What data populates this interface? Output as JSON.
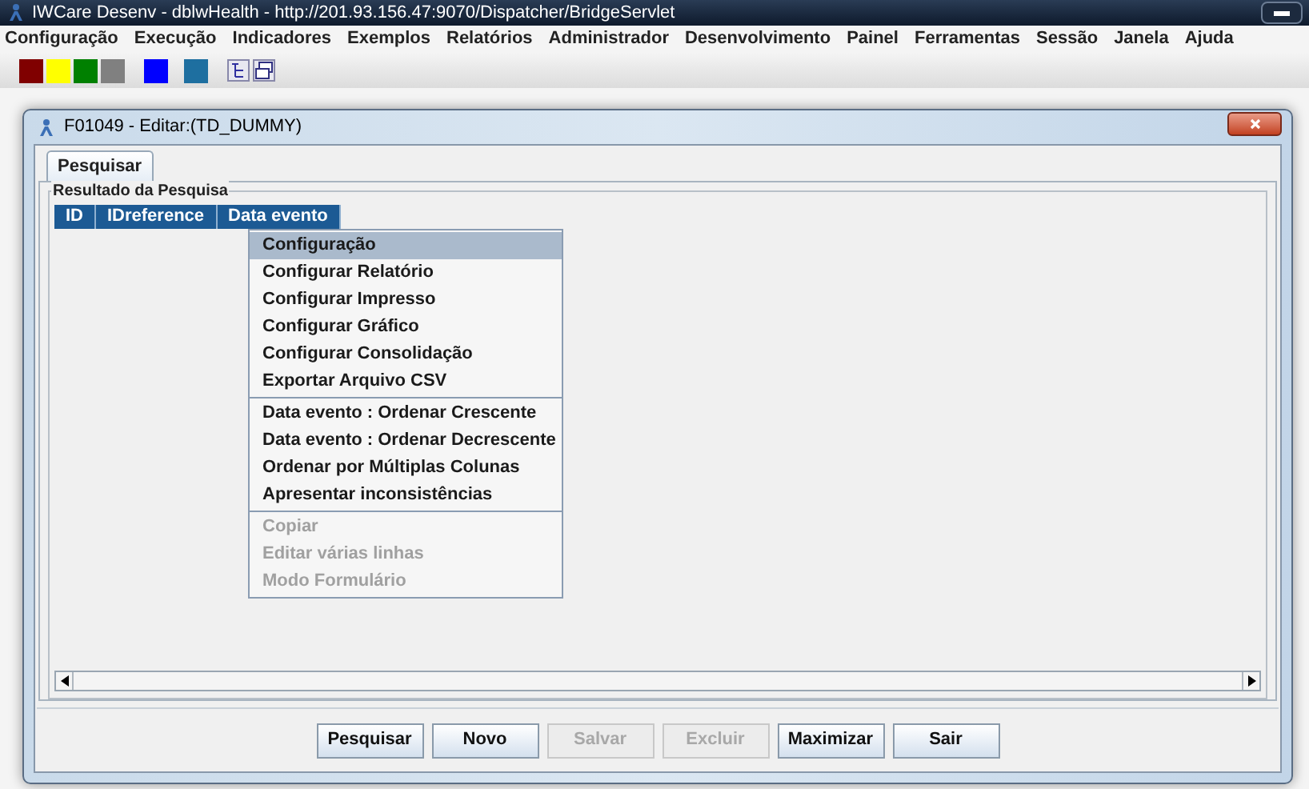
{
  "app_title": "IWCare Desenv - dblwHealth - http://201.93.156.47:9070/Dispatcher/BridgeServlet",
  "menu_bar": [
    "Configuração",
    "Execução",
    "Indicadores",
    "Exemplos",
    "Relatórios",
    "Administrador",
    "Desenvolvimento",
    "Painel",
    "Ferramentas",
    "Sessão",
    "Janela",
    "Ajuda"
  ],
  "color_swatches": [
    {
      "color": "#800000"
    },
    {
      "color": "#ffff00"
    },
    {
      "color": "#008000"
    },
    {
      "color": "#808080"
    },
    {
      "color": "#0000ff"
    },
    {
      "color": "#1e6fa0"
    }
  ],
  "window": {
    "title": "F01049 - Editar:(TD_DUMMY)",
    "tabs": [
      {
        "label": "Pesquisar",
        "selected": true
      }
    ],
    "group_title": "Resultado da Pesquisa",
    "table": {
      "columns": [
        "ID",
        "IDreference",
        "Data evento"
      ]
    },
    "context_menu": [
      [
        {
          "label": "Configuração",
          "selected": true,
          "disabled": false
        },
        {
          "label": "Configurar Relatório",
          "selected": false,
          "disabled": false
        },
        {
          "label": "Configurar Impresso",
          "selected": false,
          "disabled": false
        },
        {
          "label": "Configurar Gráfico",
          "selected": false,
          "disabled": false
        },
        {
          "label": "Configurar Consolidação",
          "selected": false,
          "disabled": false
        },
        {
          "label": "Exportar Arquivo CSV",
          "selected": false,
          "disabled": false
        }
      ],
      [
        {
          "label": "Data evento : Ordenar Crescente",
          "selected": false,
          "disabled": false
        },
        {
          "label": "Data evento : Ordenar Decrescente",
          "selected": false,
          "disabled": false
        },
        {
          "label": "Ordenar por Múltiplas Colunas",
          "selected": false,
          "disabled": false
        },
        {
          "label": "Apresentar inconsistências",
          "selected": false,
          "disabled": false
        }
      ],
      [
        {
          "label": "Copiar",
          "selected": false,
          "disabled": true
        },
        {
          "label": "Editar várias linhas",
          "selected": false,
          "disabled": true
        },
        {
          "label": "Modo Formulário",
          "selected": false,
          "disabled": true
        }
      ]
    ],
    "buttons": [
      {
        "label": "Pesquisar",
        "disabled": false
      },
      {
        "label": "Novo",
        "disabled": false
      },
      {
        "label": "Salvar",
        "disabled": true
      },
      {
        "label": "Excluir",
        "disabled": true
      },
      {
        "label": "Maximizar",
        "disabled": false
      },
      {
        "label": "Sair",
        "disabled": false
      }
    ]
  }
}
